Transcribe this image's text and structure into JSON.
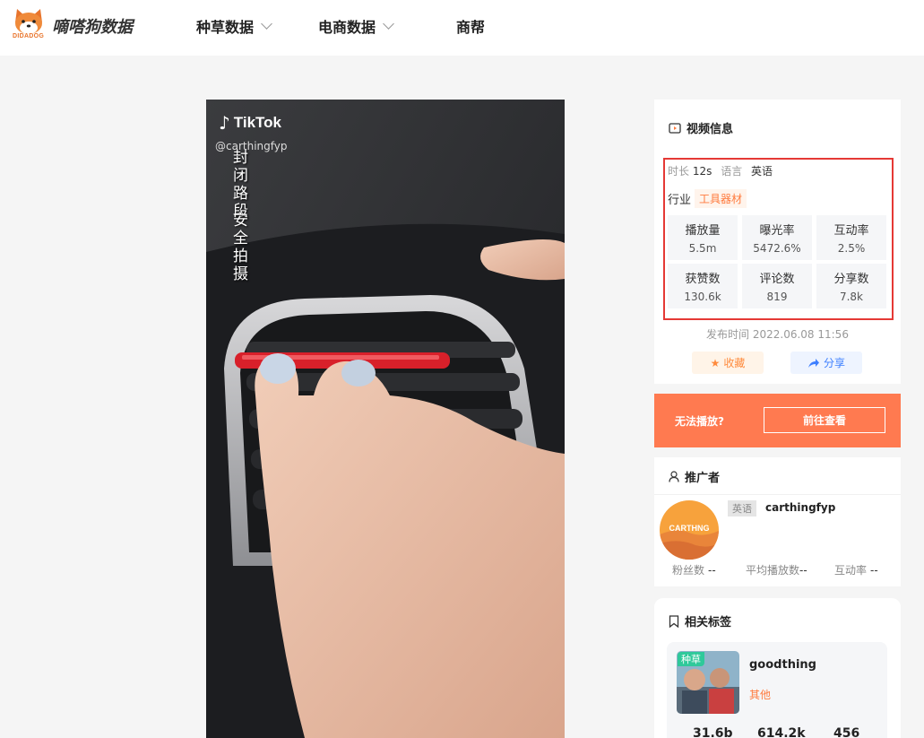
{
  "brand": {
    "name": "嘀嗒狗数据",
    "sub": "DIDADOG"
  },
  "nav": [
    {
      "label": "种草数据",
      "has_dropdown": true
    },
    {
      "label": "电商数据",
      "has_dropdown": true
    },
    {
      "label": "商帮",
      "has_dropdown": false
    }
  ],
  "video": {
    "watermark_logo": "TikTok",
    "watermark_user": "@carthingfyp",
    "caption_col1": "封闭路段",
    "caption_col2": "安全拍摄"
  },
  "video_info": {
    "title": "视频信息",
    "duration_label": "时长",
    "duration": "12s",
    "language_label": "语言",
    "language": "英语",
    "industry_label": "行业",
    "industry": "工具器材",
    "stats": [
      {
        "label": "播放量",
        "value": "5.5m"
      },
      {
        "label": "曝光率",
        "value": "5472.6%"
      },
      {
        "label": "互动率",
        "value": "2.5%"
      },
      {
        "label": "获赞数",
        "value": "130.6k"
      },
      {
        "label": "评论数",
        "value": "819"
      },
      {
        "label": "分享数",
        "value": "7.8k"
      }
    ],
    "publish_time": "发布时间 2022.06.08 11:56",
    "favorite_label": "收藏",
    "share_label": "分享"
  },
  "play_bar": {
    "message": "无法播放?",
    "button": "前往查看"
  },
  "promoter": {
    "title": "推广者",
    "avatar_text": "CARTHNG",
    "language_badge": "英语",
    "name": "carthingfyp",
    "stats": [
      {
        "label": "粉丝数",
        "value": "--"
      },
      {
        "label": "平均播放数",
        "value": "--"
      },
      {
        "label": "互动率",
        "value": "--"
      }
    ]
  },
  "related_tags": {
    "title": "相关标签",
    "items": [
      {
        "badge": "种草",
        "name": "goodthing",
        "category": "其他",
        "stats": [
          "31.6b",
          "614.2k",
          "456"
        ]
      }
    ]
  },
  "colors": {
    "accent_orange": "#ff7a50",
    "highlight_red": "#e53935",
    "share_blue": "#3d7fff",
    "tag_green": "#2fc99a"
  }
}
